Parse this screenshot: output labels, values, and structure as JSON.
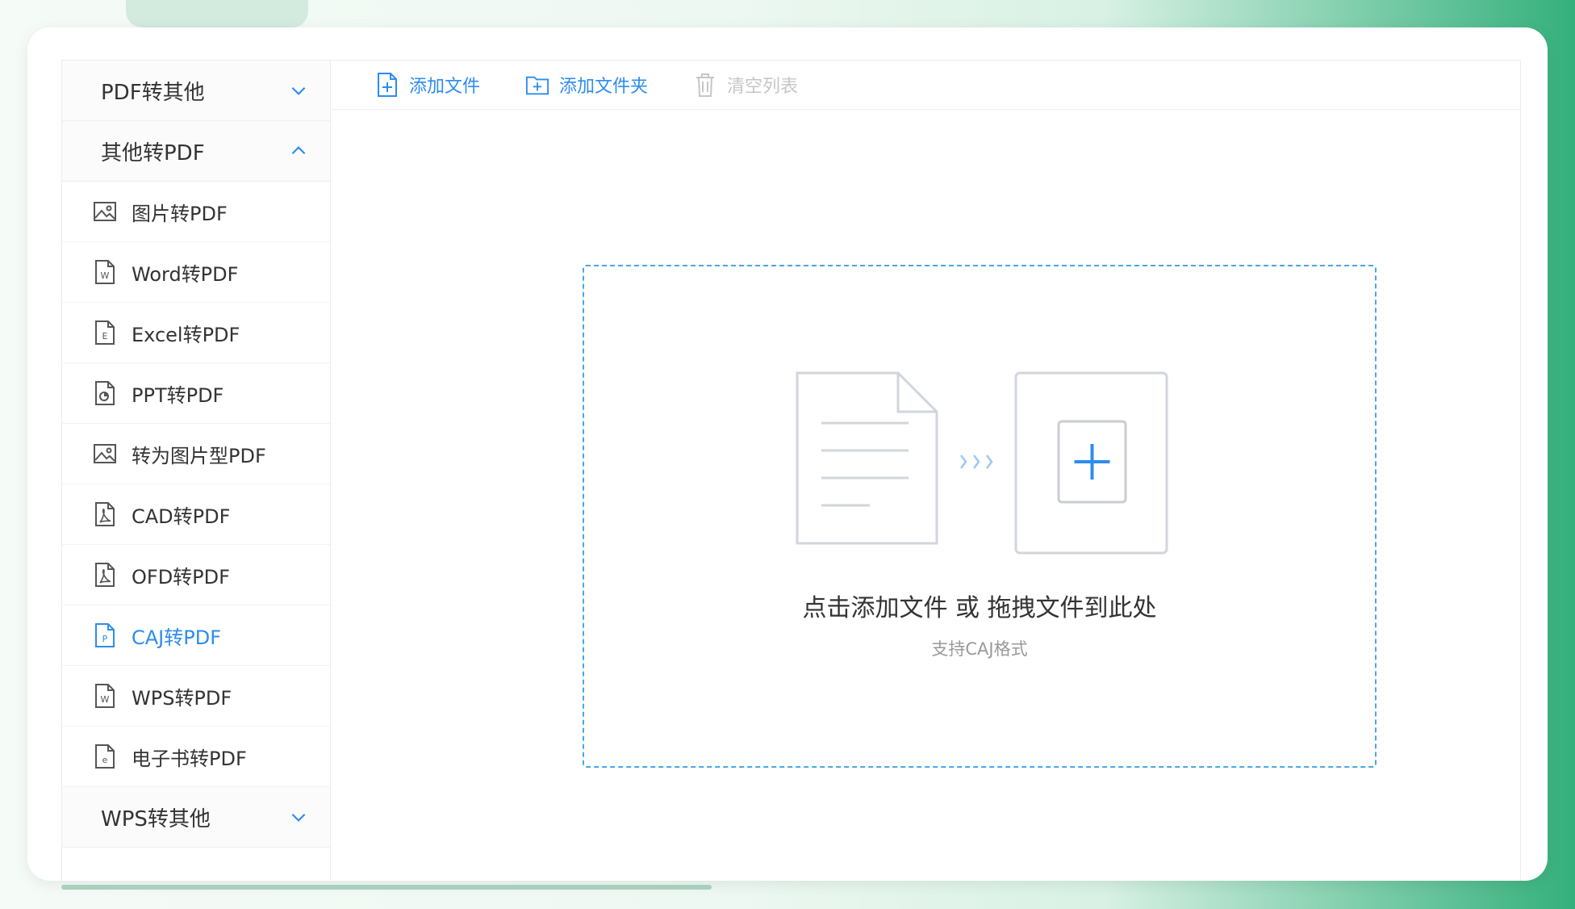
{
  "sidebar": {
    "sections": [
      {
        "label": "PDF转其他",
        "expanded": false
      },
      {
        "label": "其他转PDF",
        "expanded": true
      },
      {
        "label": "WPS转其他",
        "expanded": false
      }
    ],
    "items": [
      {
        "label": "图片转PDF",
        "icon": "image-icon"
      },
      {
        "label": "Word转PDF",
        "icon": "word-file-icon"
      },
      {
        "label": "Excel转PDF",
        "icon": "excel-file-icon"
      },
      {
        "label": "PPT转PDF",
        "icon": "ppt-file-icon"
      },
      {
        "label": "转为图片型PDF",
        "icon": "image-icon"
      },
      {
        "label": "CAD转PDF",
        "icon": "pdf-file-icon"
      },
      {
        "label": "OFD转PDF",
        "icon": "pdf-file-icon"
      },
      {
        "label": "CAJ转PDF",
        "icon": "caj-file-icon",
        "active": true
      },
      {
        "label": "WPS转PDF",
        "icon": "wps-file-icon"
      },
      {
        "label": "电子书转PDF",
        "icon": "ebook-file-icon"
      }
    ]
  },
  "toolbar": {
    "add_file": "添加文件",
    "add_folder": "添加文件夹",
    "clear_list": "清空列表"
  },
  "dropzone": {
    "title": "点击添加文件 或 拖拽文件到此处",
    "subtitle": "支持CAJ格式"
  },
  "colors": {
    "accent": "#2d8cf0",
    "dashed_border": "#4aa7e6",
    "disabled": "#c6c6c6"
  }
}
